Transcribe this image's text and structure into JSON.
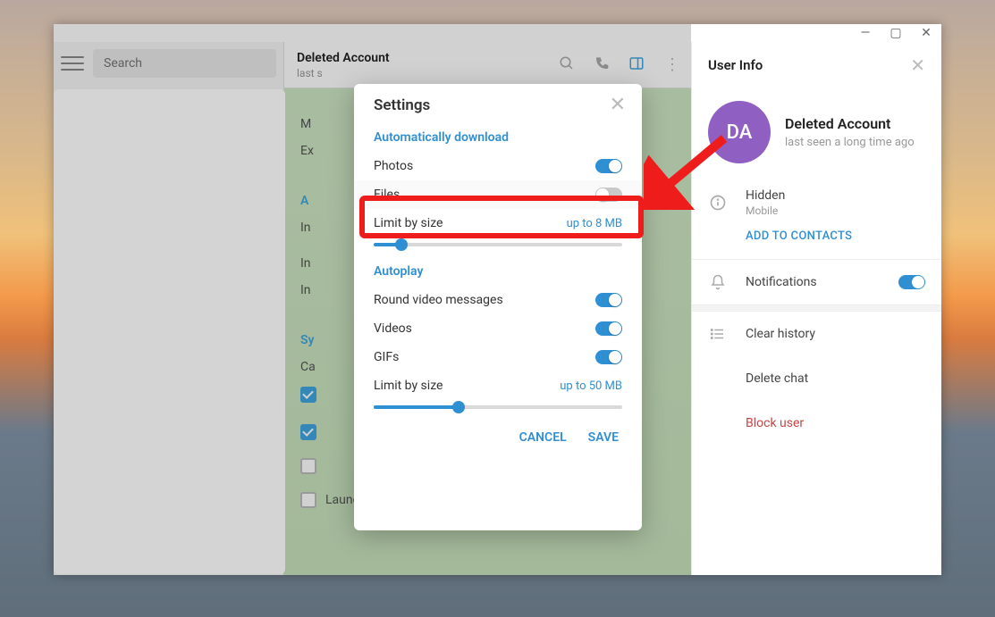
{
  "window": {
    "minimize": "—",
    "maximize": "▢",
    "close": "✕"
  },
  "search": {
    "placeholder": "Search"
  },
  "chat": {
    "title": "Deleted Account",
    "subtitle": "last s",
    "lines": {
      "m": "M",
      "ex": "Ex",
      "a": "A",
      "in1": "In",
      "in2": "In",
      "in3": "In",
      "sy": "Sy",
      "ca": "Ca",
      "launch": "Launch Telegram when system starts"
    }
  },
  "userinfo": {
    "title": "User Info",
    "name": "Deleted Account",
    "initials": "DA",
    "lastseen": "last seen a long time ago",
    "hidden": "Hidden",
    "mobile": "Mobile",
    "add": "ADD TO CONTACTS",
    "notifications": "Notifications",
    "clear": "Clear history",
    "delete": "Delete chat",
    "block": "Block user"
  },
  "modal": {
    "title": "Settings",
    "section_download": "Automatically download",
    "photos": "Photos",
    "files": "Files",
    "limit": "Limit by size",
    "limit_val1": "up to 8 MB",
    "section_autoplay": "Autoplay",
    "round": "Round video messages",
    "videos": "Videos",
    "gifs": "GIFs",
    "limit_val2": "up to 50 MB",
    "cancel": "CANCEL",
    "save": "SAVE"
  }
}
